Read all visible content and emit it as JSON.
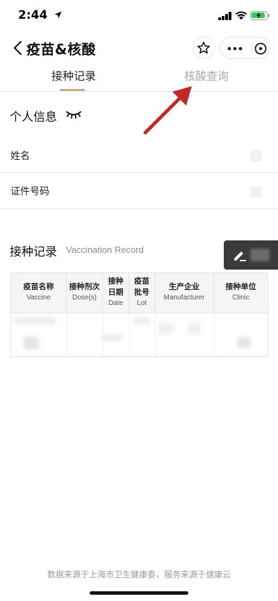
{
  "status_bar": {
    "time": "2:44"
  },
  "nav": {
    "title": "疫苗&核酸"
  },
  "tabs": [
    {
      "label": "接种记录",
      "active": true
    },
    {
      "label": "核酸查询",
      "active": false
    }
  ],
  "personal_info": {
    "title": "个人信息",
    "fields": [
      {
        "label": "姓名"
      },
      {
        "label": "证件号码"
      }
    ]
  },
  "vaccination": {
    "title": "接种记录",
    "subtitle": "Vaccination Record",
    "columns": [
      {
        "zh": "疫苗名称",
        "en": "Vaccine"
      },
      {
        "zh": "接种剂次",
        "en": "Dose(s)"
      },
      {
        "zh": "接种日期",
        "en": "Date"
      },
      {
        "zh": "疫苗批号",
        "en": "Lot"
      },
      {
        "zh": "生产企业",
        "en": "Manufacturer"
      },
      {
        "zh": "接种单位",
        "en": "Clinic"
      }
    ]
  },
  "footer": {
    "text": "数据来源于上海市卫生健康委，服务来源于健康云"
  },
  "colors": {
    "tab_accent": "#c9ae82",
    "annotation_arrow": "#c0282a",
    "battery_green": "#34c759",
    "edit_fab": "#3a3a3a"
  },
  "icons": [
    "location-arrow-icon",
    "signal-icon",
    "wifi-icon",
    "battery-icon",
    "back-chevron-icon",
    "star-icon",
    "more-dots-icon",
    "close-circle-icon",
    "eye-closed-icon",
    "edit-pencil-icon",
    "annotation-arrow-icon"
  ]
}
